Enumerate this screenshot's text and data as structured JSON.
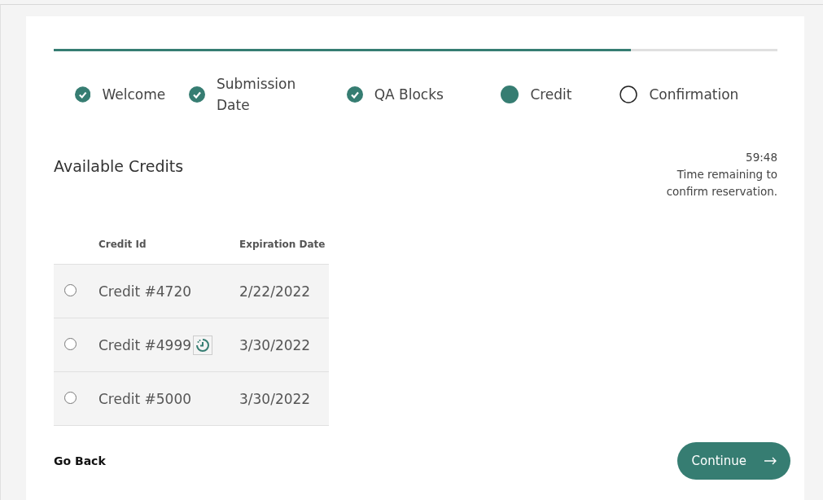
{
  "progress": {
    "level": 0.798
  },
  "steps": [
    {
      "label": "Welcome",
      "kind": "done"
    },
    {
      "label": "Submission Date",
      "kind": "done"
    },
    {
      "label": "QA Blocks",
      "kind": "done"
    },
    {
      "label": "Credit",
      "kind": "current"
    },
    {
      "label": "Confirmation",
      "kind": "todo"
    }
  ],
  "heading": "Available Credits",
  "timer": {
    "time": "59:48",
    "note": "Time remaining to confirm reservation."
  },
  "table": {
    "columns": [
      "Credit Id",
      "Expiration Date"
    ],
    "rows": [
      {
        "selected": false,
        "credit_id": "Credit #4720",
        "expiring": false,
        "expiration_date": "2/22/2022"
      },
      {
        "selected": false,
        "credit_id": "Credit #4999",
        "expiring": true,
        "expiration_date": "3/30/2022"
      },
      {
        "selected": false,
        "credit_id": "Credit #5000",
        "expiring": false,
        "expiration_date": "3/30/2022"
      }
    ]
  },
  "back_link": "Go Back",
  "continue_button": "Continue"
}
